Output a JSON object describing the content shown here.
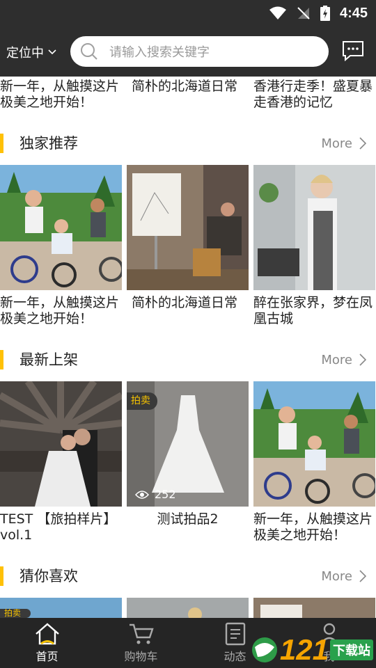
{
  "status_bar": {
    "time": "4:45"
  },
  "header": {
    "location_label": "定位中",
    "search_placeholder": "请输入搜索关键字"
  },
  "top_row_captions": [
    "新一年，从触摸这片极美之地开始！",
    "简朴的北海道日常",
    "香港行走季！盛夏暴走香港的记忆"
  ],
  "sections": [
    {
      "title": "独家推荐",
      "more_label": "More",
      "cards": [
        {
          "caption": "新一年，从触摸这片极美之地开始！"
        },
        {
          "caption": "简朴的北海道日常"
        },
        {
          "caption": "醉在张家界，梦在凤凰古城"
        }
      ]
    },
    {
      "title": "最新上架",
      "more_label": "More",
      "cards": [
        {
          "caption": "TEST 【旅拍样片】vol.1"
        },
        {
          "caption": "测试拍品2",
          "badge": "拍卖",
          "views": "252"
        },
        {
          "caption": "新一年，从触摸这片极美之地开始！"
        }
      ]
    },
    {
      "title": "猜你喜欢",
      "more_label": "More",
      "cards": [
        {
          "badge": "拍卖"
        }
      ]
    }
  ],
  "bottom_nav": [
    {
      "label": "首页",
      "icon": "home-icon",
      "active": true
    },
    {
      "label": "购物车",
      "icon": "cart-icon",
      "active": false
    },
    {
      "label": "动态",
      "icon": "feed-icon",
      "active": false
    },
    {
      "label": "我",
      "icon": "person-icon",
      "active": false
    }
  ],
  "watermark": {
    "number": "121",
    "text": "下载站"
  },
  "colors": {
    "accent": "#ffc107",
    "header_bg": "#2e2e2e",
    "nav_bg": "#252525",
    "auction_badge_text": "#f5c200"
  }
}
